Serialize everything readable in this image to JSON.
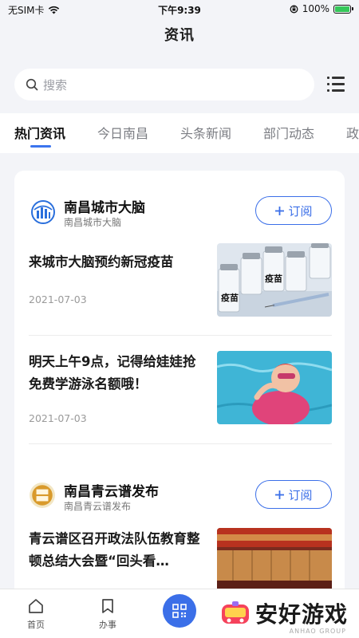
{
  "status_bar": {
    "carrier": "无SIM卡",
    "time": "下午9:39",
    "battery_percent": "100%",
    "battery_level": 1.0
  },
  "header": {
    "title": "资讯"
  },
  "search": {
    "placeholder": "搜索"
  },
  "tabs": [
    {
      "label": "热门资讯",
      "active": true
    },
    {
      "label": "今日南昌"
    },
    {
      "label": "头条新闻"
    },
    {
      "label": "部门动态"
    },
    {
      "label": "政"
    }
  ],
  "sources": [
    {
      "name": "南昌城市大脑",
      "subtitle": "南昌城市大脑",
      "subscribe_label": "订阅",
      "subscribe_icon": "plus-icon",
      "articles": [
        {
          "title": "来城市大脑预约新冠疫苗",
          "date": "2021-07-03",
          "thumb": "vaccine-vials-image",
          "thumb_text_1": "疫苗",
          "thumb_text_2": "疫苗"
        },
        {
          "title": "明天上午9点，记得给娃娃抢免费学游泳名额哦！",
          "date": "2021-07-03",
          "thumb": "child-swimming-image"
        }
      ]
    },
    {
      "name": "南昌青云谱发布",
      "subtitle": "南昌青云谱发布",
      "subscribe_label": "订阅",
      "subscribe_icon": "plus-icon",
      "articles": [
        {
          "title": "青云谱区召开政法队伍教育整顿总结大会暨“回头看…",
          "thumb": "meeting-stage-image"
        }
      ]
    }
  ],
  "bottom_nav": {
    "items": [
      {
        "label": "首页",
        "icon": "home-icon"
      },
      {
        "label": "办事",
        "icon": "bookmark-icon"
      }
    ],
    "scan_icon": "qr-scan-icon",
    "watermark": {
      "text": "安好游戏",
      "sub": "ANHAO GROUP"
    }
  },
  "colors": {
    "accent": "#3b6fe8",
    "background": "#f3f4f8"
  }
}
